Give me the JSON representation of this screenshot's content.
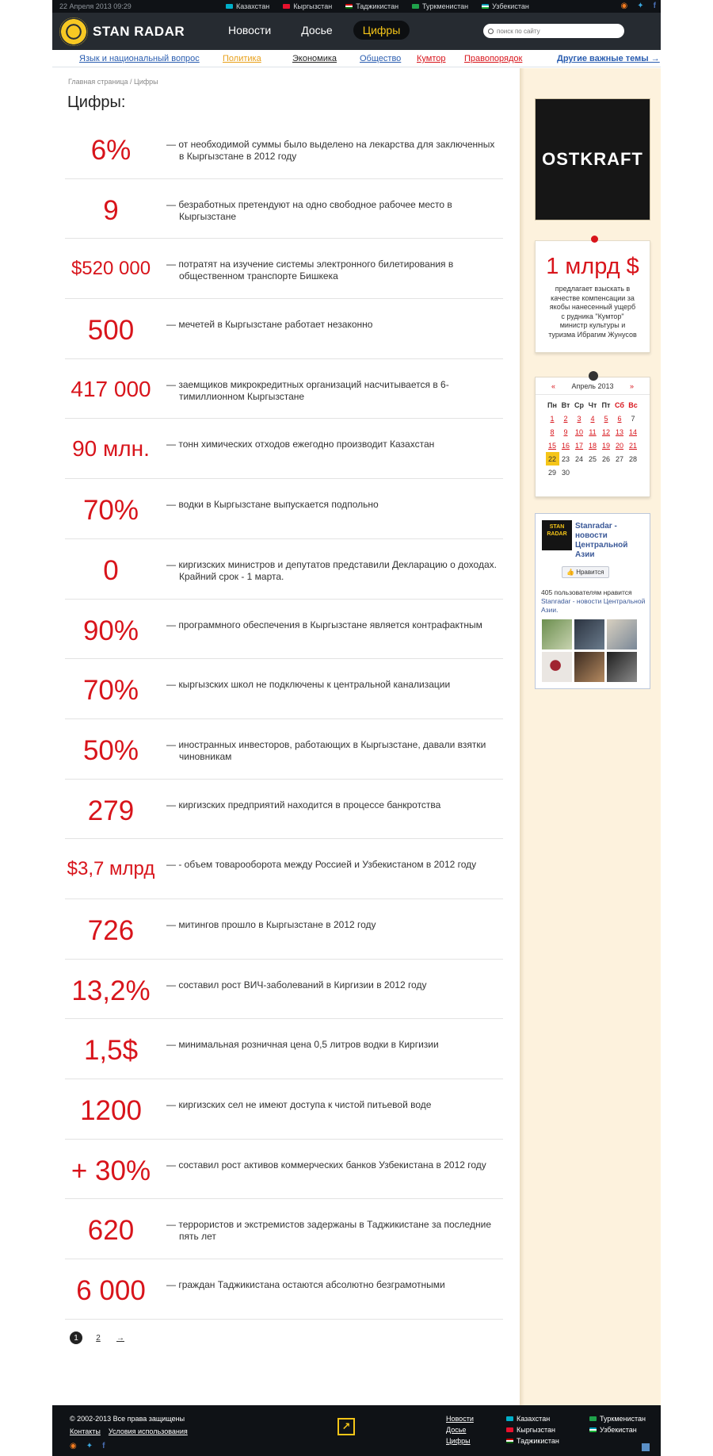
{
  "topbar": {
    "date": "22 Апреля 2013   09:29",
    "countries": [
      {
        "name": "Казахстан",
        "flag_color": "#00afca"
      },
      {
        "name": "Кыргызстан",
        "flag_color": "#e8112d"
      },
      {
        "name": "Таджикистан",
        "flag_color": "#cc0000"
      },
      {
        "name": "Туркменистан",
        "flag_color": "#1fa24b"
      },
      {
        "name": "Узбекистан",
        "flag_color": "#1eb53a"
      }
    ],
    "social": [
      "rss-icon",
      "twitter-icon",
      "facebook-icon"
    ]
  },
  "header": {
    "logo_text": "STAN RADAR",
    "nav": [
      "Новости",
      "Досье",
      "Цифры"
    ],
    "active_nav": "Цифры",
    "search_placeholder": "поиск по сайту"
  },
  "subnav": {
    "items": [
      {
        "label": "Язык и национальный вопрос",
        "color": "#2a5db0"
      },
      {
        "label": "Политика",
        "color": "#e8a01a"
      },
      {
        "label": "Экономика",
        "color": "#222222"
      },
      {
        "label": "Общество",
        "color": "#2a5db0"
      },
      {
        "label": "Кумтор",
        "color": "#d8141b"
      },
      {
        "label": "Правопорядок",
        "color": "#d8141b"
      }
    ],
    "more": "Другие важные темы →"
  },
  "breadcrumb": "Главная страница  /  Цифры",
  "page_title": "Цифры:",
  "facts": [
    {
      "num": "6%",
      "text": "— от необходимой суммы было выделено на лекарства для заключенных в Кыргызстане в 2012 году"
    },
    {
      "num": "9",
      "text": "— безработных претендуют на одно свободное рабочее место в Кыргызстане"
    },
    {
      "num": "$520 000",
      "text": "— потратят на изучение системы электронного билетирования в общественном транспорте Бишкека"
    },
    {
      "num": "500",
      "text": "— мечетей в Кыргызстане работает незаконно"
    },
    {
      "num": "417 000",
      "text": "— заемщиков микрокредитных организаций насчитывается в 6-тимиллионном Кыргызстане"
    },
    {
      "num": "90 млн.",
      "text": "— тонн химических отходов ежегодно производит Казахстан"
    },
    {
      "num": "70%",
      "text": "— водки в Кыргызстане выпускается подпольно"
    },
    {
      "num": "0",
      "text": "— киргизских министров и депутатов представили Декларацию о доходах. Крайний срок - 1 марта."
    },
    {
      "num": "90%",
      "text": "— программного обеспечения в Кыргызстане является контрафактным"
    },
    {
      "num": "70%",
      "text": "— кыргызских школ не подключены к центральной канализации"
    },
    {
      "num": "50%",
      "text": "— иностранных инвесторов, работающих в Кыргызстане, давали взятки чиновникам"
    },
    {
      "num": "279",
      "text": "— киргизских предприятий находится в процессе банкротства"
    },
    {
      "num": "$3,7 млрд",
      "text": "— - объем товарооборота между Россией и Узбекистаном в 2012 году"
    },
    {
      "num": "726",
      "text": "— митингов прошло в Кыргызстане в 2012 году"
    },
    {
      "num": "13,2%",
      "text": "— составил рост ВИЧ-заболеваний в Киргизии в 2012 году"
    },
    {
      "num": "1,5$",
      "text": "— минимальная розничная цена 0,5 литров водки в Киргизии"
    },
    {
      "num": "1200",
      "text": "— киргизских сел не имеют доступа к чистой питьевой воде"
    },
    {
      "num": "+ 30%",
      "text": "— составил рост активов коммерческих банков Узбекистана в 2012 году"
    },
    {
      "num": "620",
      "text": "— террористов и экстремистов задержаны в Таджикистане за последние пять лет"
    },
    {
      "num": "6 000",
      "text": "— граждан Таджикистана остаются абсолютно безграмотными"
    }
  ],
  "pager": {
    "current": "1",
    "next": "2",
    "arrow": "→"
  },
  "sidebar": {
    "banner_text": "OSTKRAFT",
    "big_fact": {
      "num": "1 млрд $",
      "text": "предлагает взыскать в качестве компенсации за якобы нанесенный ущерб с рудника \"Кумтор\" министр культуры и туризма Ибрагим Жунусов"
    },
    "calendar": {
      "prev": "«",
      "next": "»",
      "title": "Апрель 2013",
      "weekdays": [
        "Пн",
        "Вт",
        "Ср",
        "Чт",
        "Пт",
        "Сб",
        "Вс"
      ],
      "weeks": [
        [
          "1",
          "2",
          "3",
          "4",
          "5",
          "6",
          "7"
        ],
        [
          "8",
          "9",
          "10",
          "11",
          "12",
          "13",
          "14"
        ],
        [
          "15",
          "16",
          "17",
          "18",
          "19",
          "20",
          "21"
        ],
        [
          "22",
          "23",
          "24",
          "25",
          "26",
          "27",
          "28"
        ],
        [
          "29",
          "30",
          "",
          "",
          "",
          "",
          ""
        ]
      ],
      "today": "22"
    },
    "facebook": {
      "logo_text": "STAN RADAR",
      "page_name": "Stanradar - новости Центральной Азии",
      "like_label": "Нравится",
      "count_text": "405 пользователям нравится",
      "count_link": "Stanradar - новости Центральной Азии."
    }
  },
  "footer": {
    "copyright": "© 2002-2013 Все права защищены",
    "links": [
      "Контакты",
      "Условия использования"
    ],
    "nav": [
      "Новости",
      "Досье",
      "Цифры"
    ],
    "countries_col1": [
      "Казахстан",
      "Кыргызстан",
      "Таджикистан"
    ],
    "countries_col2": [
      "Туркменистан",
      "Узбекистан"
    ],
    "logo_glyph": "↗"
  },
  "colors": {
    "accent_red": "#d8141b",
    "accent_yellow": "#f5c518",
    "sidebar_bg": "#fdf2dd"
  }
}
